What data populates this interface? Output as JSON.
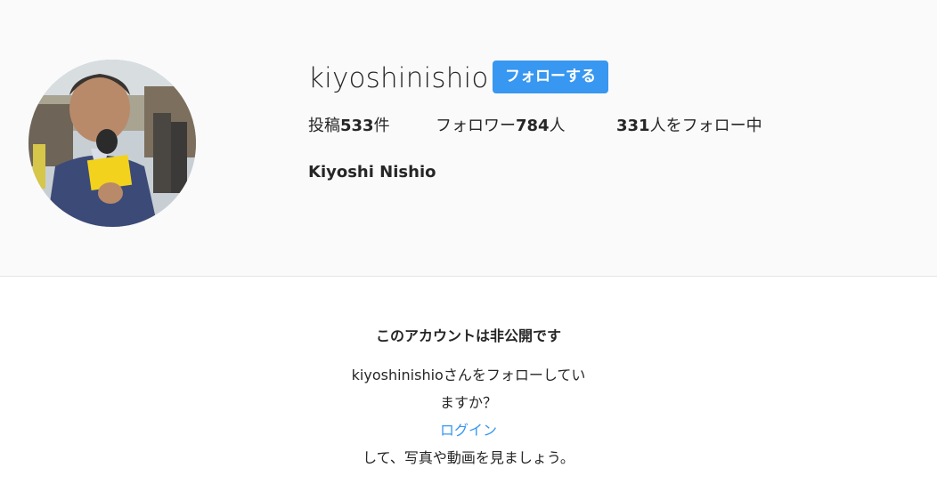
{
  "profile": {
    "username": "kiyoshinishio",
    "follow_label": "フォローする",
    "stats": {
      "posts_prefix": "投稿",
      "posts_count": "533",
      "posts_suffix": "件",
      "followers_prefix": "フォロワー",
      "followers_count": "784",
      "followers_suffix": "人",
      "following_count": "331",
      "following_suffix": "人をフォロー中"
    },
    "full_name": "Kiyoshi Nishio",
    "accent_color": "#3897f0"
  },
  "private_notice": {
    "title": "このアカウントは非公開です",
    "line1": "kiyoshinishioさんをフォローしてい",
    "line2": "ますか？",
    "login_label": "ログイン",
    "line3": "して、写真や動画を見ましょう。"
  }
}
